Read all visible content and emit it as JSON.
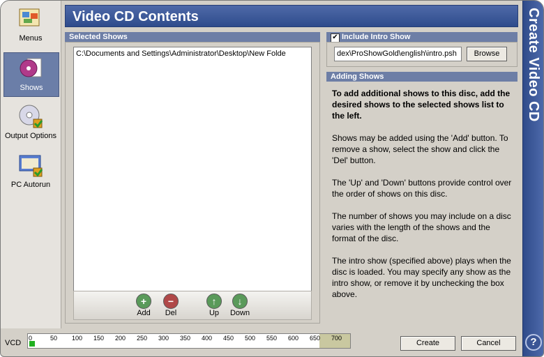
{
  "window": {
    "title": "Video CD Contents",
    "side_title": "Create Video CD",
    "help": "?"
  },
  "sidebar": {
    "items": [
      {
        "label": "Menus"
      },
      {
        "label": "Shows"
      },
      {
        "label": "Output Options"
      },
      {
        "label": "PC Autorun"
      }
    ]
  },
  "selected_shows": {
    "header": "Selected Shows",
    "items": [
      "C:\\Documents and Settings\\Administrator\\Desktop\\New Folde"
    ],
    "buttons": {
      "add": "Add",
      "del": "Del",
      "up": "Up",
      "down": "Down"
    }
  },
  "intro": {
    "header": "Include Intro Show",
    "checked": true,
    "check_mark": "✔",
    "path": "dex\\ProShowGold\\english\\intro.psh",
    "browse": "Browse"
  },
  "adding_shows": {
    "header": "Adding Shows",
    "paragraphs": [
      "To add additional shows to this disc, add the desired shows to the selected shows list to the left.",
      "Shows may be added using the 'Add' button. To remove a show, select the show and click the 'Del' button.",
      "The 'Up' and 'Down' buttons provide control over the order of shows on this disc.",
      "The number of shows you may include on a disc varies with the length of the shows and the format of the disc.",
      "The intro show (specified above) plays when the disc is loaded. You may specify any show as the intro show, or remove it by unchecking the box above."
    ]
  },
  "capacity": {
    "label": "VCD",
    "ticks": [
      "0",
      "50",
      "100",
      "150",
      "200",
      "250",
      "300",
      "350",
      "400",
      "450",
      "500",
      "550",
      "600",
      "650",
      "700"
    ],
    "used_fraction": 0.01
  },
  "footer": {
    "create": "Create",
    "cancel": "Cancel"
  },
  "colors": {
    "accent": "#2e4b8c",
    "panel_header": "#6d7ea6"
  }
}
